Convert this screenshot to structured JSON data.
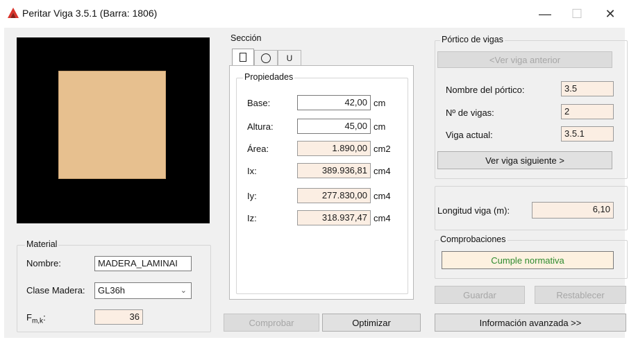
{
  "window": {
    "title": "Peritar Viga 3.5.1 (Barra: 1806)",
    "minimize_glyph": "—",
    "maximize_glyph": "☐",
    "close_glyph": "✕",
    "accent": "#d9342b"
  },
  "material": {
    "group_label": "Material",
    "nombre_label": "Nombre:",
    "nombre_value": "MADERA_LAMINAI",
    "clase_label": "Clase Madera:",
    "clase_value": "GL36h",
    "fmk_label_main": "F",
    "fmk_label_sub": "m,k",
    "fmk_label_suffix": ":",
    "fmk_value": "36"
  },
  "seccion": {
    "group_label": "Sección",
    "tabs": [
      {
        "label": "",
        "icon": "rectangle-icon"
      },
      {
        "label": "",
        "icon": "circle-icon"
      },
      {
        "label": "U",
        "icon": "u-profile-icon"
      }
    ],
    "propiedades_label": "Propiedades",
    "rows": [
      {
        "label": "Base:",
        "value": "42,00",
        "unit": "cm",
        "editable": true
      },
      {
        "label": "Altura:",
        "value": "45,00",
        "unit": "cm",
        "editable": true
      },
      {
        "label": "Área:",
        "value": "1.890,00",
        "unit": "cm2",
        "editable": false
      },
      {
        "label": "Ix:",
        "value": "389.936,81",
        "unit": "cm4",
        "editable": false
      },
      {
        "label": "Iy:",
        "value": "277.830,00",
        "unit": "cm4",
        "editable": false
      },
      {
        "label": "Iz:",
        "value": "318.937,47",
        "unit": "cm4",
        "editable": false
      }
    ]
  },
  "buttons": {
    "comprobar": "Comprobar",
    "optimizar": "Optimizar",
    "guardar": "Guardar",
    "restablecer": "Restablecer",
    "info_avanzada": "Información avanzada >>"
  },
  "portico": {
    "group_label": "Pórtico de vigas",
    "prev_button": "<Ver viga anterior",
    "nombre_label": "Nombre del pórtico:",
    "nombre_value": "3.5",
    "nvigas_label": "Nº de vigas:",
    "nvigas_value": "2",
    "actual_label": "Viga actual:",
    "actual_value": "3.5.1",
    "next_button": "Ver viga siguiente >"
  },
  "longitud": {
    "label": "Longitud viga (m):",
    "value": "6,10"
  },
  "comprobaciones": {
    "group_label": "Comprobaciones",
    "status": "Cumple normativa",
    "status_color": "#2e8b2e"
  }
}
